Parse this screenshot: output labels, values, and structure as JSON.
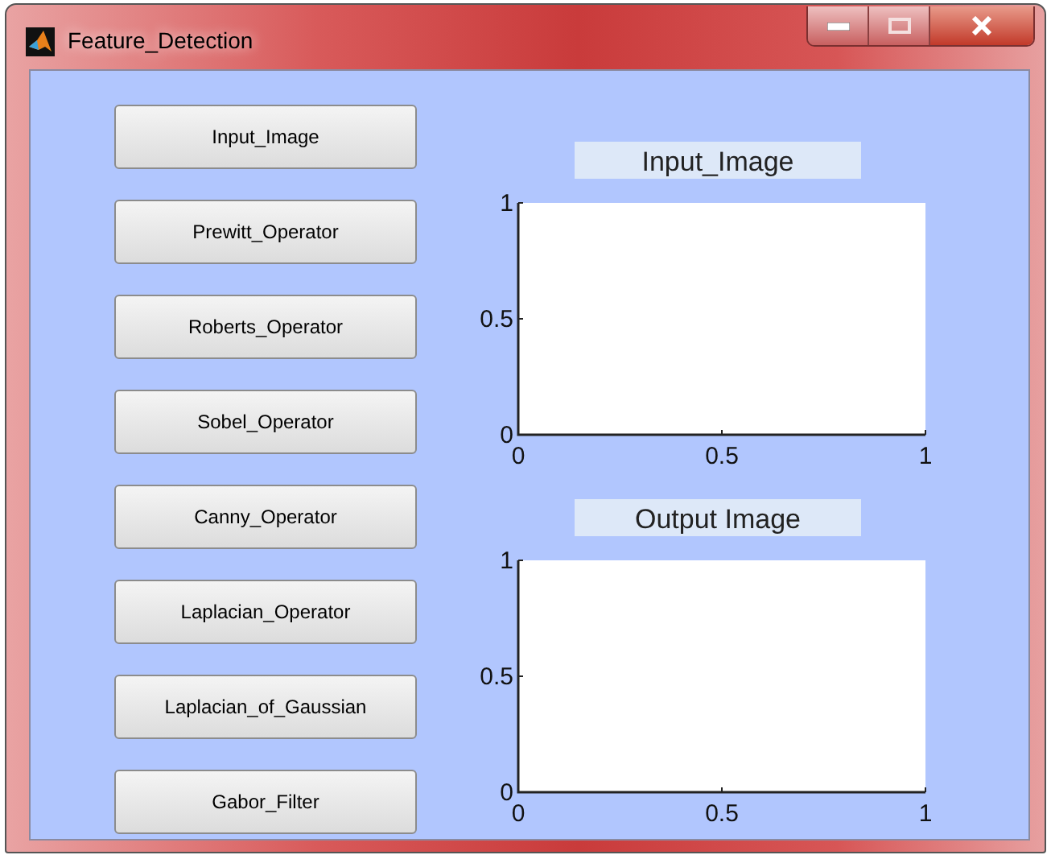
{
  "window": {
    "title": "Feature_Detection"
  },
  "buttons": [
    {
      "label": "Input_Image"
    },
    {
      "label": "Prewitt_Operator"
    },
    {
      "label": "Roberts_Operator"
    },
    {
      "label": "Sobel_Operator"
    },
    {
      "label": "Canny_Operator"
    },
    {
      "label": "Laplacian_Operator"
    },
    {
      "label": "Laplacian_of_Gaussian"
    },
    {
      "label": "Gabor_Filter"
    }
  ],
  "axes": [
    {
      "title": "Input_Image",
      "y_ticks": [
        "1",
        "0.5",
        "0"
      ],
      "x_ticks": [
        "0",
        "0.5",
        "1"
      ]
    },
    {
      "title": "Output  Image",
      "y_ticks": [
        "1",
        "0.5",
        "0"
      ],
      "x_ticks": [
        "0",
        "0.5",
        "1"
      ]
    }
  ]
}
